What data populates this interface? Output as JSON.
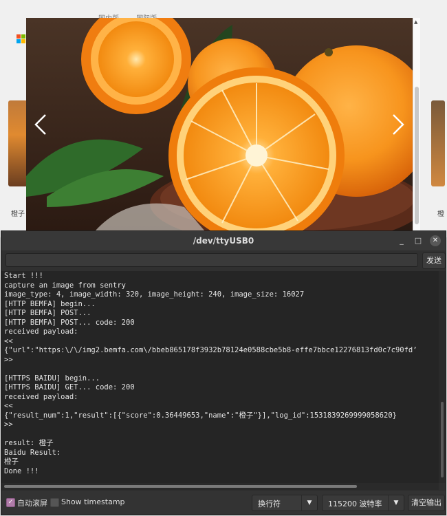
{
  "background_page": {
    "tabs": [
      "国内版",
      "国际版"
    ],
    "left_caption": "橙子",
    "right_caption": "橙"
  },
  "icons": {
    "prev": "chevron-left-icon",
    "next": "chevron-right-icon",
    "minimize": "minimize-icon",
    "maximize": "maximize-icon",
    "close": "close-icon",
    "dropdown": "chevron-down-icon"
  },
  "colors": {
    "window_bg": "#2f2f2f",
    "output_bg": "#252525",
    "text": "#e4e4e4",
    "checkbox_accent": "#b07ca8"
  },
  "serial_window": {
    "title": "/dev/ttyUSB0",
    "send_input_value": "",
    "send_button": "发送",
    "output_lines": [
      "Start !!!",
      "capture an image from sentry",
      "image_type: 4, image_width: 320, image_height: 240, image_size: 16027",
      "[HTTP BEMFA] begin...",
      "[HTTP BEMFA] POST...",
      "[HTTP BEMFA] POST... code: 200",
      "received payload:",
      "<<",
      "{\"url\":\"https:\\/\\/img2.bemfa.com\\/bbeb865178f3932b78124e0588cbe5b8-effe7bbce12276813fd0c7c90fd’",
      ">>",
      "",
      "[HTTPS BAIDU] begin...",
      "[HTTPS BAIDU] GET... code: 200",
      "received payload:",
      "<<",
      "{\"result_num\":1,\"result\":[{\"score\":0.36449653,\"name\":\"橙子\"}],\"log_id\":1531839269999058620}",
      ">>",
      "",
      "result: 橙子",
      "Baidu Result:",
      "橙子",
      "Done !!!"
    ],
    "autoscroll_label": "自动滚屏",
    "autoscroll_checked": true,
    "timestamp_label": "Show timestamp",
    "timestamp_checked": false,
    "line_ending": "换行符",
    "baud_rate": "115200 波特率",
    "clear_button": "清空输出"
  }
}
